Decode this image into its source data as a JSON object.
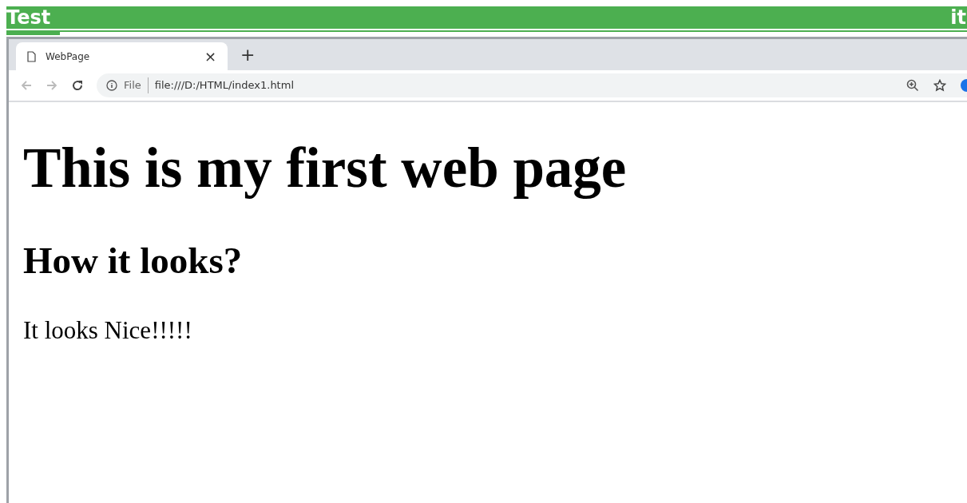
{
  "header": {
    "title": "Test",
    "right_text": "it"
  },
  "browser": {
    "tabs": [
      {
        "label": "WebPage",
        "close": "×",
        "selected": true
      }
    ],
    "new_tab": "+",
    "address": {
      "scheme_label": "File",
      "url": "file:///D:/HTML/index1.html"
    }
  },
  "page": {
    "heading": "This is my first web page",
    "subheading": "How it looks?",
    "paragraph": "It looks Nice!!!!!"
  }
}
